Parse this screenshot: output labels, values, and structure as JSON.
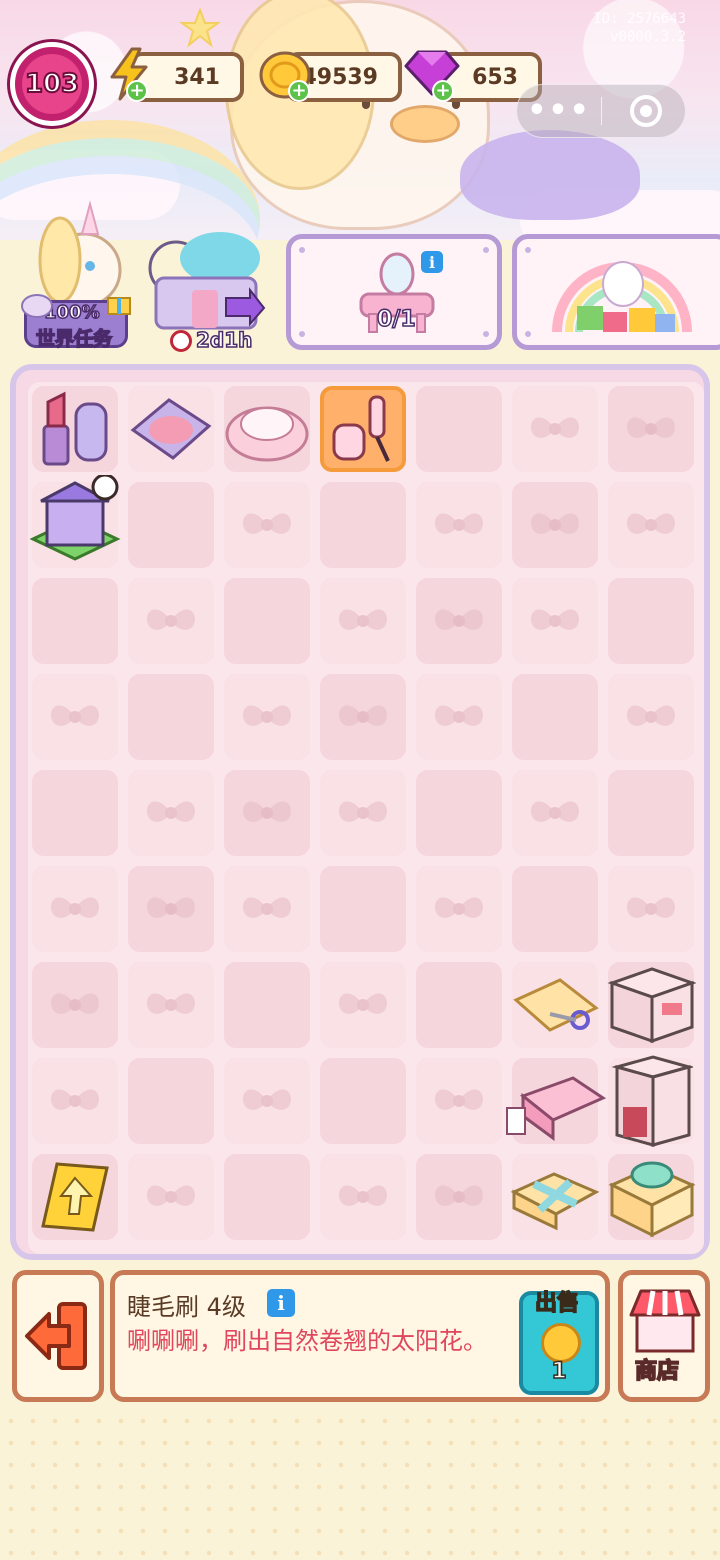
{
  "watermark": {
    "line1": "ID: 2576643",
    "line2": "v0000.3.2"
  },
  "hud": {
    "level": "103",
    "energy": "341",
    "coins": "49539",
    "gems": "653"
  },
  "colors": {
    "energy": "#f7c21c",
    "coin": "#ffc93a",
    "gem": "#c63fd6",
    "plus": "#5cc24a",
    "board_frame": "#d7c6ea",
    "selected_cell": "#ffb06a",
    "info_text": "#e0465d",
    "sell_button": "#34c8d6"
  },
  "features": {
    "world_task": {
      "progress": "100%",
      "label": "世界任务"
    },
    "event": {
      "timer": "2d1h"
    },
    "vanity": {
      "counter": "0/1"
    }
  },
  "board": {
    "rows": 9,
    "cols": 7,
    "selected": {
      "row": 0,
      "col": 3
    },
    "items": [
      {
        "row": 0,
        "col": 0,
        "name": "lipstick-item"
      },
      {
        "row": 0,
        "col": 1,
        "name": "blush-compact-item"
      },
      {
        "row": 0,
        "col": 2,
        "name": "powder-puff-item"
      },
      {
        "row": 0,
        "col": 3,
        "name": "mascara-brush-item"
      },
      {
        "row": 1,
        "col": 0,
        "name": "shop-building-item"
      },
      {
        "row": 6,
        "col": 5,
        "name": "cloth-scissors-item"
      },
      {
        "row": 6,
        "col": 6,
        "name": "nightstand-item"
      },
      {
        "row": 7,
        "col": 5,
        "name": "bed-item"
      },
      {
        "row": 7,
        "col": 6,
        "name": "cabinet-item"
      },
      {
        "row": 8,
        "col": 0,
        "name": "upgrade-card-item"
      },
      {
        "row": 8,
        "col": 5,
        "name": "gift-box-item"
      },
      {
        "row": 8,
        "col": 6,
        "name": "gift-box-large-item"
      }
    ]
  },
  "info_panel": {
    "title": "睫毛刷 4级",
    "description": "唰唰唰，刷出自然卷翘的太阳花。",
    "sell_label": "出售",
    "sell_price": "1"
  },
  "shop": {
    "label": "商店"
  }
}
